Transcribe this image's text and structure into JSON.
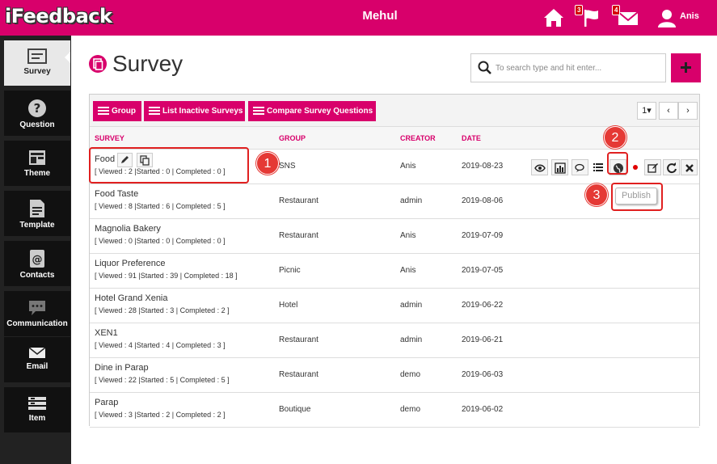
{
  "app": {
    "logo": "iFeedback",
    "header_title": "Mehul",
    "user_name": "Anis",
    "flag_badge": "3",
    "mail_badge": "4"
  },
  "sidebar": {
    "items": [
      {
        "label": "Survey",
        "icon": "survey-icon",
        "active": true
      },
      {
        "label": "Question",
        "icon": "question-icon"
      },
      {
        "label": "Theme",
        "icon": "theme-icon"
      },
      {
        "label": "Template",
        "icon": "template-icon"
      },
      {
        "label": "Contacts",
        "icon": "contacts-icon"
      },
      {
        "label": "Communication",
        "icon": "communication-icon"
      },
      {
        "label": "Email",
        "icon": "email-icon"
      },
      {
        "label": "Item",
        "icon": "item-icon"
      }
    ]
  },
  "page": {
    "title": "Survey",
    "search_placeholder": "To search type and hit enter..."
  },
  "toolbar": {
    "group_label": "Group",
    "inactive_label": "List Inactive Surveys",
    "compare_label": "Compare Survey Questions",
    "page_select": "1▾",
    "prev": "‹",
    "next": "›"
  },
  "table": {
    "headers": {
      "survey": "SURVEY",
      "group": "GROUP",
      "creator": "CREATOR",
      "date": "DATE"
    },
    "rows": [
      {
        "name": "Food",
        "stats": "[ Viewed : 2 |Started : 0 | Completed : 0 ]",
        "group": "SNS",
        "creator": "Anis",
        "date": "2019-08-23"
      },
      {
        "name": "Food Taste",
        "stats": "[ Viewed : 8 |Started : 6 | Completed : 5 ]",
        "group": "Restaurant",
        "creator": "admin",
        "date": "2019-08-06"
      },
      {
        "name": "Magnolia Bakery",
        "stats": "[ Viewed : 0 |Started : 0 | Completed : 0 ]",
        "group": "Restaurant",
        "creator": "Anis",
        "date": "2019-07-09"
      },
      {
        "name": "Liquor Preference",
        "stats": "[ Viewed : 91 |Started : 39 | Completed : 18 ]",
        "group": "Picnic",
        "creator": "Anis",
        "date": "2019-07-05"
      },
      {
        "name": "Hotel Grand Xenia",
        "stats": "[ Viewed : 28 |Started : 3 | Completed : 2 ]",
        "group": "Hotel",
        "creator": "admin",
        "date": "2019-06-22"
      },
      {
        "name": "XEN1",
        "stats": "[ Viewed : 4 |Started : 4 | Completed : 3 ]",
        "group": "Restaurant",
        "creator": "admin",
        "date": "2019-06-21"
      },
      {
        "name": "Dine in Parap",
        "stats": "[ Viewed : 22 |Started : 5 | Completed : 5 ]",
        "group": "Restaurant",
        "creator": "demo",
        "date": "2019-06-03"
      },
      {
        "name": "Parap",
        "stats": "[ Viewed : 3 |Started : 2 | Completed : 2 ]",
        "group": "Boutique",
        "creator": "demo",
        "date": "2019-06-02"
      }
    ]
  },
  "actions": {
    "publish_label": "Publish",
    "icons": [
      "eye-icon",
      "chart-icon",
      "comments-icon",
      "list-icon",
      "globe-icon",
      "status-dot-icon",
      "edit-icon",
      "refresh-icon",
      "delete-icon"
    ]
  },
  "annotations": {
    "step1": "1",
    "step2": "2",
    "step3": "3"
  },
  "colors": {
    "brand": "#d8006b",
    "sidebar": "#222222",
    "annotation": "#e53935"
  }
}
